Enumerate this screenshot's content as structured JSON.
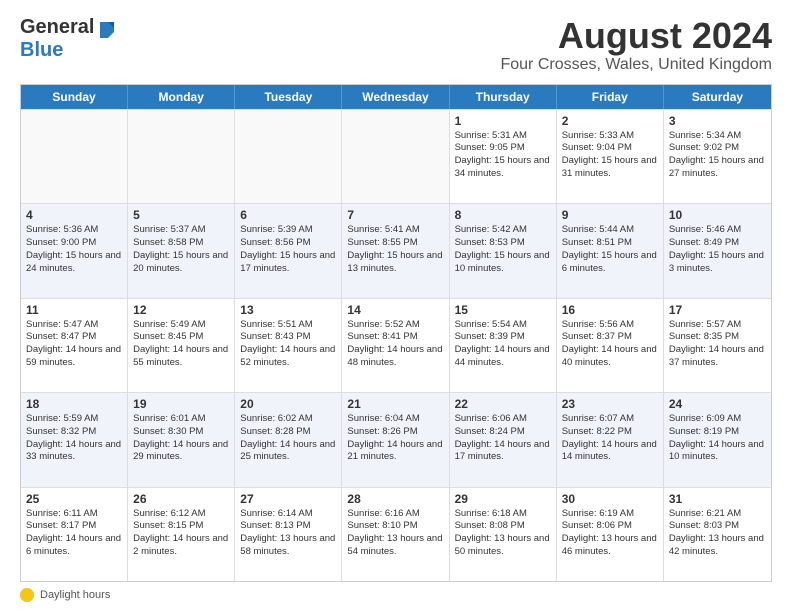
{
  "header": {
    "logo_general": "General",
    "logo_blue": "Blue",
    "title": "August 2024",
    "subtitle": "Four Crosses, Wales, United Kingdom"
  },
  "calendar": {
    "days": [
      "Sunday",
      "Monday",
      "Tuesday",
      "Wednesday",
      "Thursday",
      "Friday",
      "Saturday"
    ],
    "rows": [
      [
        {
          "day": "",
          "info": ""
        },
        {
          "day": "",
          "info": ""
        },
        {
          "day": "",
          "info": ""
        },
        {
          "day": "",
          "info": ""
        },
        {
          "day": "1",
          "info": "Sunrise: 5:31 AM\nSunset: 9:05 PM\nDaylight: 15 hours and 34 minutes."
        },
        {
          "day": "2",
          "info": "Sunrise: 5:33 AM\nSunset: 9:04 PM\nDaylight: 15 hours and 31 minutes."
        },
        {
          "day": "3",
          "info": "Sunrise: 5:34 AM\nSunset: 9:02 PM\nDaylight: 15 hours and 27 minutes."
        }
      ],
      [
        {
          "day": "4",
          "info": "Sunrise: 5:36 AM\nSunset: 9:00 PM\nDaylight: 15 hours and 24 minutes."
        },
        {
          "day": "5",
          "info": "Sunrise: 5:37 AM\nSunset: 8:58 PM\nDaylight: 15 hours and 20 minutes."
        },
        {
          "day": "6",
          "info": "Sunrise: 5:39 AM\nSunset: 8:56 PM\nDaylight: 15 hours and 17 minutes."
        },
        {
          "day": "7",
          "info": "Sunrise: 5:41 AM\nSunset: 8:55 PM\nDaylight: 15 hours and 13 minutes."
        },
        {
          "day": "8",
          "info": "Sunrise: 5:42 AM\nSunset: 8:53 PM\nDaylight: 15 hours and 10 minutes."
        },
        {
          "day": "9",
          "info": "Sunrise: 5:44 AM\nSunset: 8:51 PM\nDaylight: 15 hours and 6 minutes."
        },
        {
          "day": "10",
          "info": "Sunrise: 5:46 AM\nSunset: 8:49 PM\nDaylight: 15 hours and 3 minutes."
        }
      ],
      [
        {
          "day": "11",
          "info": "Sunrise: 5:47 AM\nSunset: 8:47 PM\nDaylight: 14 hours and 59 minutes."
        },
        {
          "day": "12",
          "info": "Sunrise: 5:49 AM\nSunset: 8:45 PM\nDaylight: 14 hours and 55 minutes."
        },
        {
          "day": "13",
          "info": "Sunrise: 5:51 AM\nSunset: 8:43 PM\nDaylight: 14 hours and 52 minutes."
        },
        {
          "day": "14",
          "info": "Sunrise: 5:52 AM\nSunset: 8:41 PM\nDaylight: 14 hours and 48 minutes."
        },
        {
          "day": "15",
          "info": "Sunrise: 5:54 AM\nSunset: 8:39 PM\nDaylight: 14 hours and 44 minutes."
        },
        {
          "day": "16",
          "info": "Sunrise: 5:56 AM\nSunset: 8:37 PM\nDaylight: 14 hours and 40 minutes."
        },
        {
          "day": "17",
          "info": "Sunrise: 5:57 AM\nSunset: 8:35 PM\nDaylight: 14 hours and 37 minutes."
        }
      ],
      [
        {
          "day": "18",
          "info": "Sunrise: 5:59 AM\nSunset: 8:32 PM\nDaylight: 14 hours and 33 minutes."
        },
        {
          "day": "19",
          "info": "Sunrise: 6:01 AM\nSunset: 8:30 PM\nDaylight: 14 hours and 29 minutes."
        },
        {
          "day": "20",
          "info": "Sunrise: 6:02 AM\nSunset: 8:28 PM\nDaylight: 14 hours and 25 minutes."
        },
        {
          "day": "21",
          "info": "Sunrise: 6:04 AM\nSunset: 8:26 PM\nDaylight: 14 hours and 21 minutes."
        },
        {
          "day": "22",
          "info": "Sunrise: 6:06 AM\nSunset: 8:24 PM\nDaylight: 14 hours and 17 minutes."
        },
        {
          "day": "23",
          "info": "Sunrise: 6:07 AM\nSunset: 8:22 PM\nDaylight: 14 hours and 14 minutes."
        },
        {
          "day": "24",
          "info": "Sunrise: 6:09 AM\nSunset: 8:19 PM\nDaylight: 14 hours and 10 minutes."
        }
      ],
      [
        {
          "day": "25",
          "info": "Sunrise: 6:11 AM\nSunset: 8:17 PM\nDaylight: 14 hours and 6 minutes."
        },
        {
          "day": "26",
          "info": "Sunrise: 6:12 AM\nSunset: 8:15 PM\nDaylight: 14 hours and 2 minutes."
        },
        {
          "day": "27",
          "info": "Sunrise: 6:14 AM\nSunset: 8:13 PM\nDaylight: 13 hours and 58 minutes."
        },
        {
          "day": "28",
          "info": "Sunrise: 6:16 AM\nSunset: 8:10 PM\nDaylight: 13 hours and 54 minutes."
        },
        {
          "day": "29",
          "info": "Sunrise: 6:18 AM\nSunset: 8:08 PM\nDaylight: 13 hours and 50 minutes."
        },
        {
          "day": "30",
          "info": "Sunrise: 6:19 AM\nSunset: 8:06 PM\nDaylight: 13 hours and 46 minutes."
        },
        {
          "day": "31",
          "info": "Sunrise: 6:21 AM\nSunset: 8:03 PM\nDaylight: 13 hours and 42 minutes."
        }
      ]
    ]
  },
  "legend": {
    "text": "Daylight hours"
  }
}
